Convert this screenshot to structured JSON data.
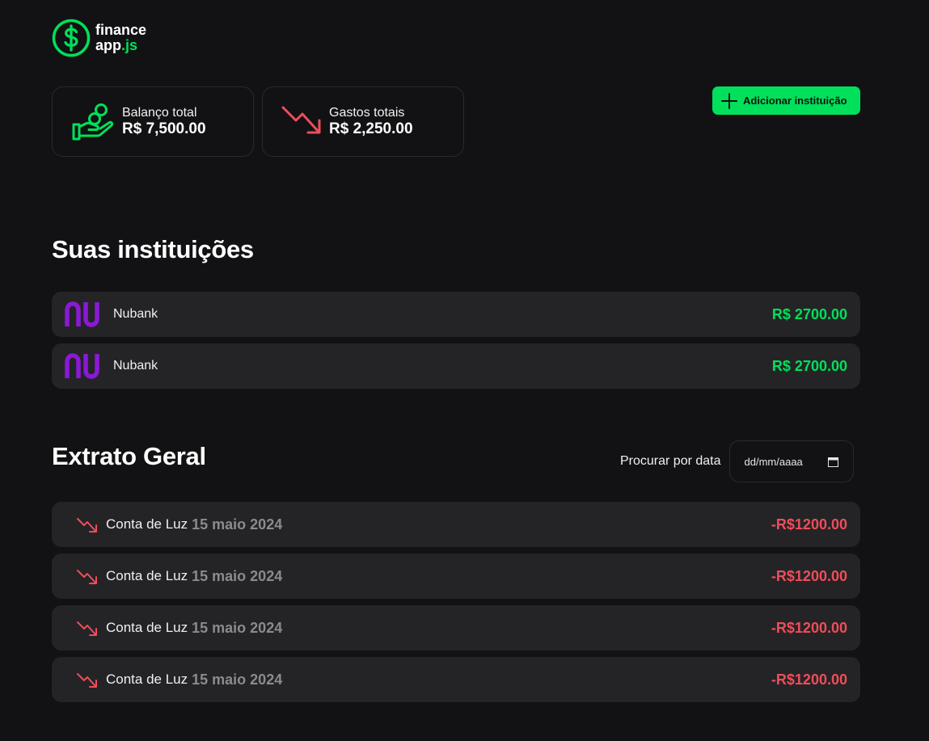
{
  "app": {
    "name_line1": "finance",
    "name_line2_base": "app",
    "name_line2_accent": ".js"
  },
  "summary": {
    "balance": {
      "label": "Balanço total",
      "value": "R$ 7,500.00",
      "icon": "hand-coins-icon"
    },
    "expenses": {
      "label": "Gastos totais",
      "value": "R$ 2,250.00",
      "icon": "trend-down-icon"
    }
  },
  "toolbar": {
    "add_institution_label": "Adicionar instituição",
    "add_icon": "plus-icon"
  },
  "institutions": {
    "title": "Suas instituições",
    "items": [
      {
        "name": "Nubank",
        "amount": "R$ 2700.00",
        "logo": "nubank-logo"
      },
      {
        "name": "Nubank",
        "amount": "R$ 2700.00",
        "logo": "nubank-logo"
      }
    ]
  },
  "statement": {
    "title": "Extrato Geral",
    "search_label": "Procurar por data",
    "date_placeholder": "dd/mm/aaaa",
    "items": [
      {
        "description": "Conta de Luz",
        "date": "15 maio 2024",
        "amount": "-R$1200.00",
        "icon": "trend-down-icon"
      },
      {
        "description": "Conta de Luz",
        "date": "15 maio 2024",
        "amount": "-R$1200.00",
        "icon": "trend-down-icon"
      },
      {
        "description": "Conta de Luz",
        "date": "15 maio 2024",
        "amount": "-R$1200.00",
        "icon": "trend-down-icon"
      },
      {
        "description": "Conta de Luz",
        "date": "15 maio 2024",
        "amount": "-R$1200.00",
        "icon": "trend-down-icon"
      }
    ]
  },
  "colors": {
    "accent": "#00e05a",
    "negative": "#ef4d5b",
    "nubank": "#8a19d6",
    "background": "#121214",
    "row": "#242426"
  }
}
